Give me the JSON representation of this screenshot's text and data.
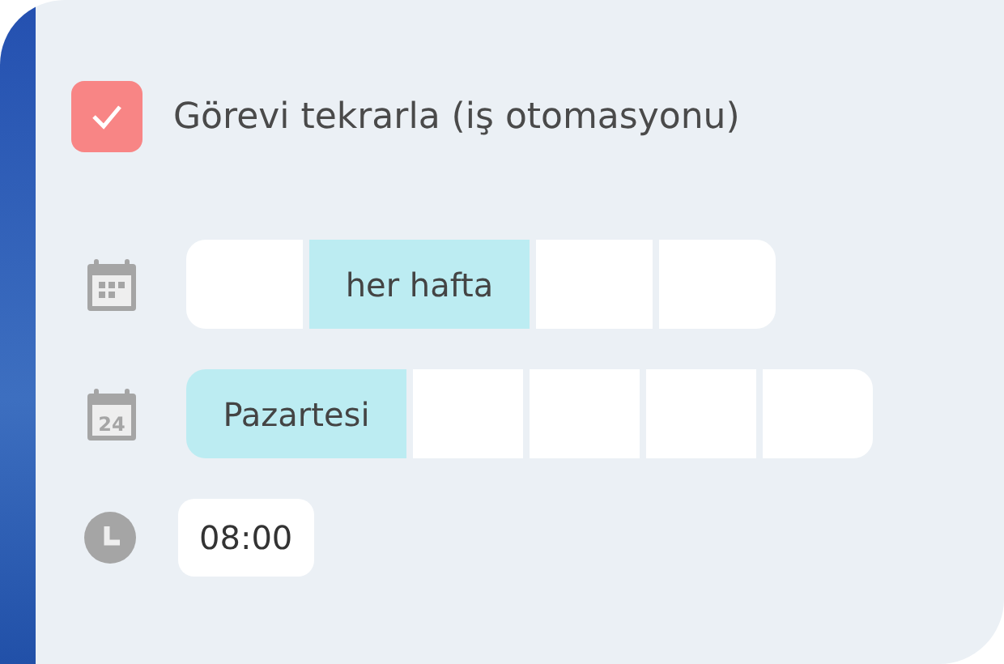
{
  "repeat": {
    "label": "Görevi tekrarla (iş otomasyonu)",
    "checked": true
  },
  "frequency": {
    "options": [
      {
        "selected": false
      },
      {
        "label": "her hafta",
        "selected": true
      },
      {
        "selected": false
      },
      {
        "selected": false
      }
    ]
  },
  "weekday": {
    "icon_text": "24",
    "options": [
      {
        "label": "Pazartesi",
        "selected": true
      },
      {
        "selected": false
      },
      {
        "selected": false
      },
      {
        "selected": false
      },
      {
        "selected": false
      }
    ]
  },
  "time": {
    "value": "08:00"
  }
}
